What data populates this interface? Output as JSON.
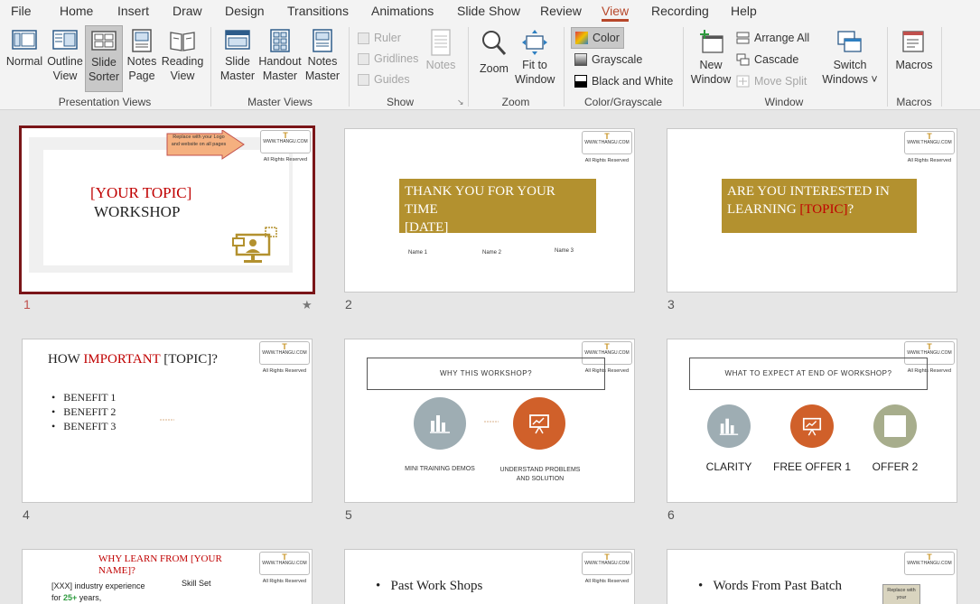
{
  "menu": [
    "File",
    "Home",
    "Insert",
    "Draw",
    "Design",
    "Transitions",
    "Animations",
    "Slide Show",
    "Review",
    "View",
    "Recording",
    "Help"
  ],
  "ribbon": {
    "presentation_views": {
      "label": "Presentation Views",
      "normal": "Normal",
      "outline_1": "Outline",
      "outline_2": "View",
      "sorter_1": "Slide",
      "sorter_2": "Sorter",
      "notes_1": "Notes",
      "notes_2": "Page",
      "reading_1": "Reading",
      "reading_2": "View"
    },
    "master_views": {
      "label": "Master Views",
      "slide_1": "Slide",
      "slide_2": "Master",
      "handout_1": "Handout",
      "handout_2": "Master",
      "notes_1": "Notes",
      "notes_2": "Master"
    },
    "show": {
      "label": "Show",
      "ruler": "Ruler",
      "gridlines": "Gridlines",
      "guides": "Guides",
      "notes": "Notes"
    },
    "zoom": {
      "label": "Zoom",
      "zoom": "Zoom",
      "fit_1": "Fit to",
      "fit_2": "Window"
    },
    "color": {
      "label": "Color/Grayscale",
      "color": "Color",
      "grayscale": "Grayscale",
      "bw": "Black and White"
    },
    "window": {
      "label": "Window",
      "new_1": "New",
      "new_2": "Window",
      "arrange_all": "Arrange All",
      "cascade": "Cascade",
      "move_split": "Move Split",
      "switch_1": "Switch",
      "switch_2": "Windows ˅"
    },
    "macros": {
      "label": "Macros",
      "macros": "Macros"
    }
  },
  "slides": {
    "s1": {
      "num": "1",
      "callout": "Replace with your Logo and website on all pages",
      "topic": "[YOUR TOPIC]",
      "workshop": "WORKSHOP",
      "star": "★"
    },
    "s2": {
      "num": "2",
      "title": "THANK YOU FOR YOUR TIME",
      "date": "[DATE]",
      "name1": "Name 1",
      "name2": "Name 2",
      "name3": "Name 3"
    },
    "s3": {
      "num": "3",
      "line1": "ARE YOU INTERESTED IN",
      "line2a": "LEARNING ",
      "topic": "[TOPIC]",
      "q": "?"
    },
    "s4": {
      "num": "4",
      "how": "HOW ",
      "important": "IMPORTANT ",
      "topic": "[TOPIC]?",
      "b1": "BENEFIT 1",
      "b2": "BENEFIT 2",
      "b3": "BENEFIT 3"
    },
    "s5": {
      "num": "5",
      "title": "WHY  THIS WORKSHOP?",
      "left": "MINI TRAINING DEMOS",
      "right_1": "UNDERSTAND PROBLEMS",
      "right_2": "AND SOLUTION"
    },
    "s6": {
      "num": "6",
      "title": "WHAT TO EXPECT AT END OF WORKSHOP?",
      "c1": "CLARITY",
      "c2": "FREE OFFER 1",
      "c3": "OFFER 2"
    },
    "s7": {
      "title_1": "WHY LEARN FROM [YOUR",
      "title_2": "NAME]?",
      "exp_1": "[XXX] industry experience",
      "exp_2a": "for ",
      "exp_2b": "25+",
      "exp_2c": " years,",
      "skill": "Skill Set"
    },
    "s8": {
      "bullet": "Past Work Shops"
    },
    "s9": {
      "bullet": "Words From Past Batch",
      "callout": "Replace with your"
    }
  },
  "logo": {
    "brand": "THANGU CONSULTING",
    "site": "WWW.THANGU.COM",
    "rights": "All Rights Reserved"
  },
  "colors": {
    "accent": "#b7472a",
    "gold": "#b3912f",
    "selected_border": "#7a1518",
    "red": "#c00000",
    "circle_gray": "#9eadb3",
    "circle_orange": "#d0602a",
    "circle_olive": "#a7ad8c"
  }
}
